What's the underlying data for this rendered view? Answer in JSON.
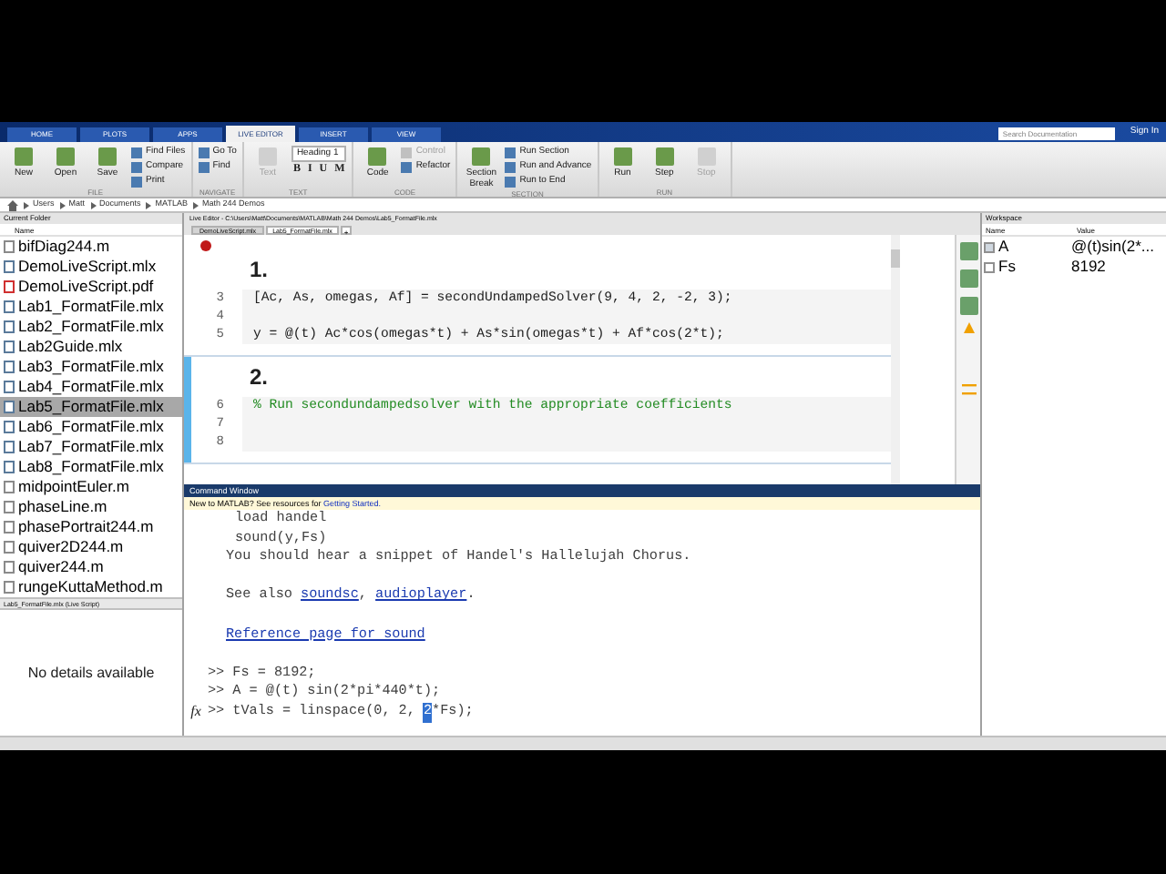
{
  "tabs": [
    {
      "label": "HOME",
      "selected": false
    },
    {
      "label": "PLOTS",
      "selected": false
    },
    {
      "label": "APPS",
      "selected": false
    },
    {
      "label": "LIVE EDITOR",
      "selected": true
    },
    {
      "label": "INSERT",
      "selected": false
    },
    {
      "label": "VIEW",
      "selected": false
    }
  ],
  "search": {
    "placeholder": "Search Documentation"
  },
  "sign_in": "Sign In",
  "toolstrip": [
    {
      "label": "FILE",
      "items": [
        {
          "label": "New",
          "kind": "large",
          "disabled": false
        },
        {
          "label": "Open",
          "kind": "large",
          "disabled": false
        },
        {
          "label": "Save",
          "kind": "large",
          "disabled": false
        },
        {
          "label": "Find Files",
          "kind": "small",
          "disabled": false
        },
        {
          "label": "Compare",
          "kind": "small",
          "disabled": false
        },
        {
          "label": "Print",
          "kind": "small",
          "disabled": false
        }
      ]
    },
    {
      "label": "NAVIGATE",
      "items": [
        {
          "label": "Go To",
          "kind": "small",
          "disabled": false
        },
        {
          "label": "Find",
          "kind": "small",
          "disabled": false
        }
      ]
    },
    {
      "label": "TEXT",
      "items": [
        {
          "label": "Text",
          "kind": "large",
          "disabled": true
        },
        {
          "label": "Heading 1",
          "kind": "dropdown",
          "disabled": false
        },
        {
          "label": "B",
          "kind": "format",
          "disabled": false
        },
        {
          "label": "I",
          "kind": "format",
          "disabled": false
        },
        {
          "label": "U",
          "kind": "format",
          "disabled": false
        },
        {
          "label": "M",
          "kind": "format",
          "disabled": false
        }
      ]
    },
    {
      "label": "CODE",
      "items": [
        {
          "label": "Code",
          "kind": "large",
          "disabled": false
        },
        {
          "label": "Control",
          "kind": "small",
          "disabled": true
        },
        {
          "label": "Refactor",
          "kind": "small",
          "disabled": false
        }
      ]
    },
    {
      "label": "SECTION",
      "items": [
        {
          "label": "Section Break",
          "kind": "large",
          "disabled": false
        },
        {
          "label": "Run Section",
          "kind": "small",
          "disabled": false
        },
        {
          "label": "Run and Advance",
          "kind": "small",
          "disabled": false
        },
        {
          "label": "Run to End",
          "kind": "small",
          "disabled": false
        }
      ]
    },
    {
      "label": "RUN",
      "items": [
        {
          "label": "Run",
          "kind": "large",
          "disabled": false
        },
        {
          "label": "Step",
          "kind": "large",
          "disabled": false
        },
        {
          "label": "Stop",
          "kind": "large",
          "disabled": true
        }
      ]
    }
  ],
  "address": [
    "Users",
    "Matt",
    "Documents",
    "MATLAB",
    "Math 244 Demos"
  ],
  "current_folder": {
    "title": "Current Folder",
    "column": "Name",
    "files": [
      {
        "name": "bifDiag244.m",
        "kind": "m",
        "selected": false
      },
      {
        "name": "DemoLiveScript.mlx",
        "kind": "mlx",
        "selected": false
      },
      {
        "name": "DemoLiveScript.pdf",
        "kind": "pdf",
        "selected": false
      },
      {
        "name": "Lab1_FormatFile.mlx",
        "kind": "mlx",
        "selected": false
      },
      {
        "name": "Lab2_FormatFile.mlx",
        "kind": "mlx",
        "selected": false
      },
      {
        "name": "Lab2Guide.mlx",
        "kind": "mlx",
        "selected": false
      },
      {
        "name": "Lab3_FormatFile.mlx",
        "kind": "mlx",
        "selected": false
      },
      {
        "name": "Lab4_FormatFile.mlx",
        "kind": "mlx",
        "selected": false
      },
      {
        "name": "Lab5_FormatFile.mlx",
        "kind": "mlx",
        "selected": true
      },
      {
        "name": "Lab6_FormatFile.mlx",
        "kind": "mlx",
        "selected": false
      },
      {
        "name": "Lab7_FormatFile.mlx",
        "kind": "mlx",
        "selected": false
      },
      {
        "name": "Lab8_FormatFile.mlx",
        "kind": "mlx",
        "selected": false
      },
      {
        "name": "midpointEuler.m",
        "kind": "m",
        "selected": false
      },
      {
        "name": "phaseLine.m",
        "kind": "m",
        "selected": false
      },
      {
        "name": "phasePortrait244.m",
        "kind": "m",
        "selected": false
      },
      {
        "name": "quiver2D244.m",
        "kind": "m",
        "selected": false
      },
      {
        "name": "quiver244.m",
        "kind": "m",
        "selected": false
      },
      {
        "name": "rungeKuttaMethod.m",
        "kind": "m",
        "selected": false
      }
    ],
    "details_title": "Lab5_FormatFile.mlx  (Live Script)",
    "details_message": "No details available"
  },
  "editor": {
    "title": "Live Editor - C:\\Users\\Matt\\Documents\\MATLAB\\Math 244 Demos\\Lab5_FormatFile.mlx",
    "tabs": [
      {
        "label": "DemoLiveScript.mlx",
        "selected": false
      },
      {
        "label": "Lab5_FormatFile.mlx",
        "selected": true
      }
    ],
    "add_tab": "+",
    "sections": [
      {
        "heading": "1.",
        "selected": false,
        "lines": [
          {
            "number": "3",
            "code": "[Ac, As, omegas, Af] = secondUndampedSolver(9, 4, 2, -2, 3);",
            "kind": "code"
          },
          {
            "number": "4"
          },
          {
            "number": "5",
            "code": "y = @(t) Ac*cos(omegas*t) + As*sin(omegas*t) + Af*cos(2*t);",
            "kind": "code"
          }
        ]
      },
      {
        "heading": "2.",
        "selected": true,
        "lines": [
          {
            "number": "6",
            "code": "% Run secondundampedsolver with the appropriate coefficients",
            "kind": "comment"
          },
          {
            "number": "7"
          },
          {
            "number": "8"
          }
        ]
      }
    ]
  },
  "command_window": {
    "title": "Command Window",
    "notice": "New to MATLAB? See resources for ",
    "notice_link": "Getting Started.",
    "lines": [
      {
        "kind": "example",
        "parts": [
          {
            "text": "load handel",
            "kind": "plain"
          }
        ]
      },
      {
        "kind": "example",
        "parts": [
          {
            "text": "sound(y,Fs)",
            "kind": "plain"
          }
        ]
      },
      {
        "kind": "output",
        "parts": [
          {
            "text": "You should hear a snippet of Handel's Hallelujah Chorus.",
            "kind": "plain"
          }
        ]
      },
      {
        "kind": "blank"
      },
      {
        "kind": "output",
        "parts": [
          {
            "text": "See also ",
            "kind": "plain"
          },
          {
            "text": "soundsc",
            "kind": "link"
          },
          {
            "text": ", ",
            "kind": "plain"
          },
          {
            "text": "audioplayer",
            "kind": "link"
          },
          {
            "text": ".",
            "kind": "plain"
          }
        ]
      },
      {
        "kind": "blank"
      },
      {
        "kind": "output",
        "parts": [
          {
            "text": "Reference page for sound",
            "kind": "link"
          }
        ]
      },
      {
        "kind": "blank"
      },
      {
        "kind": "input",
        "parts": [
          {
            "text": ">> Fs = 8192;",
            "kind": "plain"
          }
        ]
      },
      {
        "kind": "input",
        "parts": [
          {
            "text": ">> A = @(t) sin(2*pi*440*t);",
            "kind": "plain"
          }
        ]
      },
      {
        "kind": "input",
        "prompt": "fx",
        "parts": [
          {
            "text": ">> tVals = linspace(0, 2, ",
            "kind": "plain"
          },
          {
            "text": "2",
            "kind": "selected"
          },
          {
            "text": "*Fs);",
            "kind": "plain"
          }
        ]
      }
    ]
  },
  "workspace": {
    "title": "Workspace",
    "columns": [
      "Name",
      "Value"
    ],
    "variables": [
      {
        "name": "A",
        "value": "@(t)sin(2*...",
        "kind": "function"
      },
      {
        "name": "Fs",
        "value": "8192",
        "kind": "number"
      }
    ]
  }
}
